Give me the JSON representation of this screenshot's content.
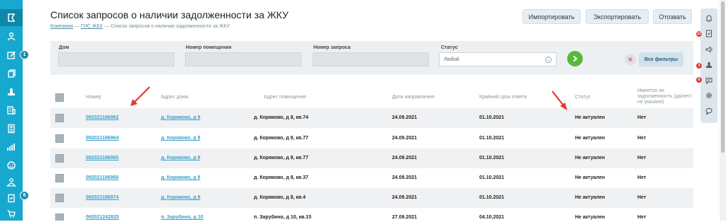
{
  "page": {
    "title": "Список запросов о наличии задолженности за ЖКУ",
    "breadcrumb": [
      "Компания",
      "ГИС ЖКХ",
      "Список запросов о наличии задолженности за ЖКУ"
    ],
    "breadcrumb_sep": "—"
  },
  "toolbar": {
    "import_label": "Импортировать",
    "export_label": "Экспортировать",
    "recall_label": "Отозвать"
  },
  "filters": {
    "house_label": "Дом",
    "room_label": "Номер помещения",
    "request_label": "Номер запроса",
    "status_label": "Статус",
    "status_value": "Любой",
    "all_filters_label": "Все фильтры",
    "go_icon": "arrow-right-icon",
    "clear_icon": "close-icon"
  },
  "table": {
    "columns": [
      "Номер",
      "Адрес дома",
      "Адрес помещения",
      "Дата направления",
      "Крайний срок ответа",
      "Статус",
      "Имеется ли задолженность (да/нет/не указано)"
    ],
    "rows": [
      {
        "number": "092021186962",
        "house": "д. Коряково, д 8",
        "room": "д. Коряково, д 8, кв.74",
        "sent": "24.09.2021",
        "deadline": "01.10.2021",
        "status": "Не актуален",
        "debt": "Нет"
      },
      {
        "number": "092021186964",
        "house": "д. Коряково, д 8",
        "room": "д. Коряково, д 8, кв.77",
        "sent": "24.09.2021",
        "deadline": "01.10.2021",
        "status": "Не актуален",
        "debt": "Нет"
      },
      {
        "number": "092021186965",
        "house": "д. Коряково, д 8",
        "room": "д. Коряково, д 8, кв.77",
        "sent": "24.09.2021",
        "deadline": "01.10.2021",
        "status": "Не актуален",
        "debt": "Нет"
      },
      {
        "number": "092021186966",
        "house": "д. Коряково, д 8",
        "room": "д. Коряково, д 8, кв.37",
        "sent": "24.09.2021",
        "deadline": "01.10.2021",
        "status": "Не актуален",
        "debt": "Нет"
      },
      {
        "number": "092021186974",
        "house": "д. Коряково, д 8",
        "room": "д. Коряково, д 8, кв.4",
        "sent": "24.09.2021",
        "deadline": "01.10.2021",
        "status": "Не актуален",
        "debt": "Нет"
      },
      {
        "number": "092021242825",
        "house": "п. Зарубино, д 10",
        "room": "п. Зарубино, д 10, кв.15",
        "sent": "27.09.2021",
        "deadline": "04.10.2021",
        "status": "Не актуален",
        "debt": "Нет"
      }
    ]
  },
  "left_nav": {
    "items": [
      "flag-icon",
      "users-icon",
      "edit-icon",
      "documents-icon",
      "stamp-icon",
      "building-icon",
      "calculator-icon",
      "chart-icon",
      "sad-face-icon",
      "users-group-icon",
      "clipboard-icon",
      "cart-icon"
    ],
    "badges": {
      "edit": "1",
      "clipboard": "6"
    }
  },
  "right_nav": {
    "items": [
      "bell-icon",
      "clipboard-check-icon",
      "megaphone-icon",
      "stamp-icon",
      "message-icon",
      "gear-icon",
      "chat-icon"
    ],
    "badges": {
      "clipboard": "12",
      "stamp": "3",
      "message": "6"
    }
  },
  "colors": {
    "accent": "#17a8cf",
    "link": "#3aa0c9",
    "go": "#59b83a",
    "annotation": "#e53b2c",
    "badge": "#e23333"
  }
}
